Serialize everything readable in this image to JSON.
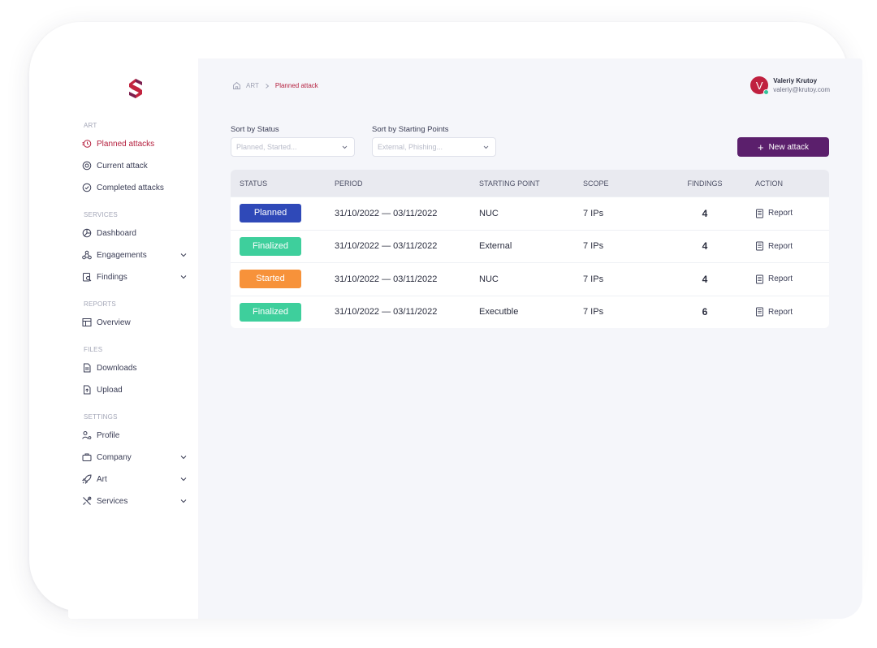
{
  "colors": {
    "accent": "#b5213f",
    "brand_purple": "#5b1f6c",
    "planned": "#2f49b8",
    "finalized": "#3ecf9c",
    "started": "#f7923a"
  },
  "sidebar": {
    "sections": [
      {
        "title": "ART",
        "items": [
          {
            "label": "Planned attacks",
            "icon": "clock-icon",
            "active": true
          },
          {
            "label": "Current attack",
            "icon": "target-icon"
          },
          {
            "label": "Completed attacks",
            "icon": "check-circle-icon"
          }
        ]
      },
      {
        "title": "SERVICES",
        "items": [
          {
            "label": "Dashboard",
            "icon": "dashboard-icon"
          },
          {
            "label": "Engagements",
            "icon": "engagements-icon",
            "expandable": true
          },
          {
            "label": "Findings",
            "icon": "findings-icon",
            "expandable": true
          }
        ]
      },
      {
        "title": "REPORTS",
        "items": [
          {
            "label": "Overview",
            "icon": "table-icon"
          }
        ]
      },
      {
        "title": "FILES",
        "items": [
          {
            "label": "Downloads",
            "icon": "document-icon"
          },
          {
            "label": "Upload",
            "icon": "upload-icon"
          }
        ]
      },
      {
        "title": "SETTINGS",
        "items": [
          {
            "label": "Profile",
            "icon": "profile-icon"
          },
          {
            "label": "Company",
            "icon": "briefcase-icon",
            "expandable": true
          },
          {
            "label": "Art",
            "icon": "rocket-icon",
            "expandable": true
          },
          {
            "label": "Services",
            "icon": "tools-icon",
            "expandable": true
          }
        ]
      }
    ]
  },
  "breadcrumb": {
    "root": "ART",
    "current": "Planned attack"
  },
  "user": {
    "initial": "V",
    "name": "Valeriy Krutoy",
    "email": "valeriy@krutoy.com"
  },
  "filters": {
    "status": {
      "label": "Sort by Status",
      "placeholder": "Planned, Started..."
    },
    "starting": {
      "label": "Sort by Starting Points",
      "placeholder": "External, Phishing..."
    }
  },
  "new_attack_label": "New attack",
  "table": {
    "headers": [
      "STATUS",
      "PERIOD",
      "STARTING POINT",
      "SCOPE",
      "FINDINGS",
      "ACTION"
    ],
    "rows": [
      {
        "status": "Planned",
        "status_key": "planned",
        "period": "31/10/2022 — 03/11/2022",
        "starting_point": "NUC",
        "scope": "7 IPs",
        "findings": "4",
        "action": "Report"
      },
      {
        "status": "Finalized",
        "status_key": "finalized",
        "period": "31/10/2022 — 03/11/2022",
        "starting_point": "External",
        "scope": "7 IPs",
        "findings": "4",
        "action": "Report"
      },
      {
        "status": "Started",
        "status_key": "started",
        "period": "31/10/2022 — 03/11/2022",
        "starting_point": "NUC",
        "scope": "7 IPs",
        "findings": "4",
        "action": "Report"
      },
      {
        "status": "Finalized",
        "status_key": "finalized",
        "period": "31/10/2022 — 03/11/2022",
        "starting_point": "Executble",
        "scope": "7 IPs",
        "findings": "6",
        "action": "Report"
      }
    ]
  }
}
